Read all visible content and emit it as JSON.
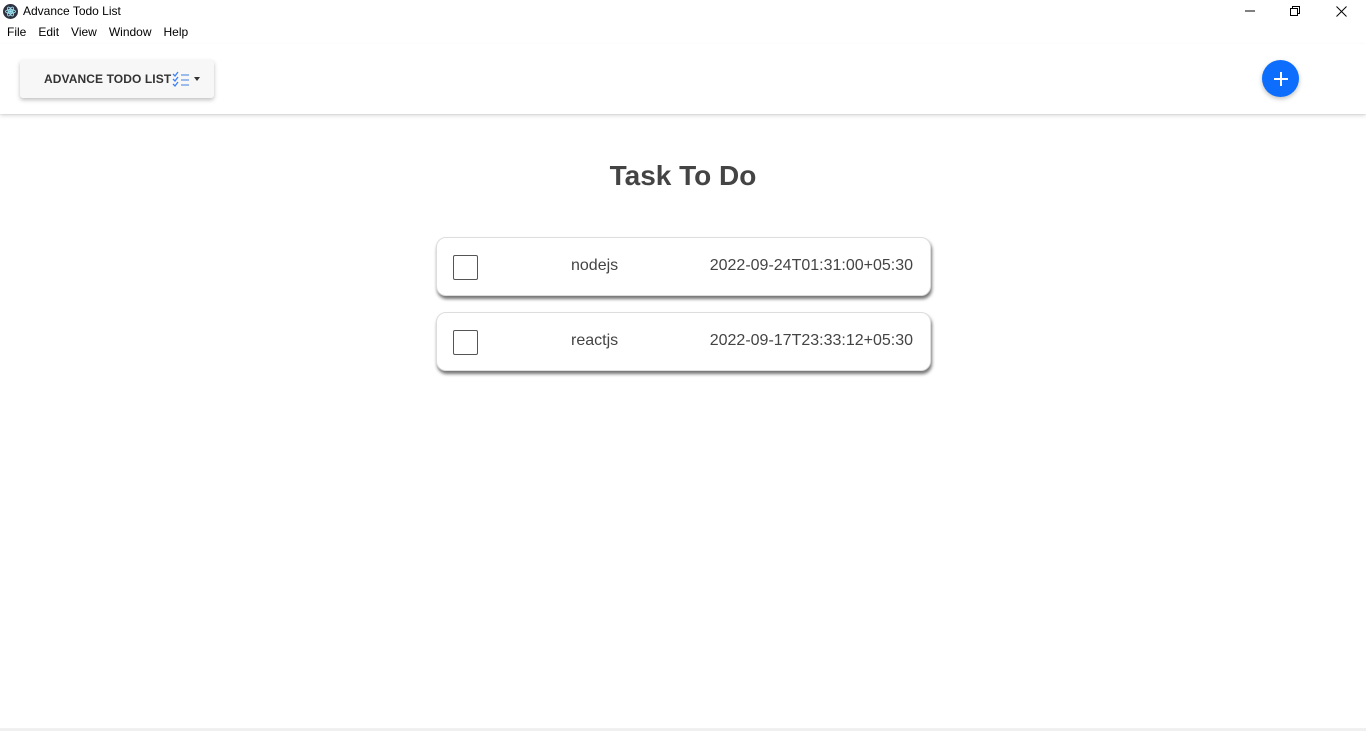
{
  "window": {
    "title": "Advance Todo List"
  },
  "menu": [
    "File",
    "Edit",
    "View",
    "Window",
    "Help"
  ],
  "header": {
    "brand_label": "ADVANCE TODO LIST",
    "brand_icon": "checklist-icon",
    "add_icon": "plus-icon"
  },
  "main": {
    "title": "Task To Do",
    "tasks": [
      {
        "name": "nodejs",
        "date": "2022-09-24T01:31:00+05:30",
        "checked": false
      },
      {
        "name": "reactjs",
        "date": "2022-09-17T23:33:12+05:30",
        "checked": false
      }
    ]
  },
  "colors": {
    "accent": "#0d6efd",
    "title_text": "#444444"
  }
}
